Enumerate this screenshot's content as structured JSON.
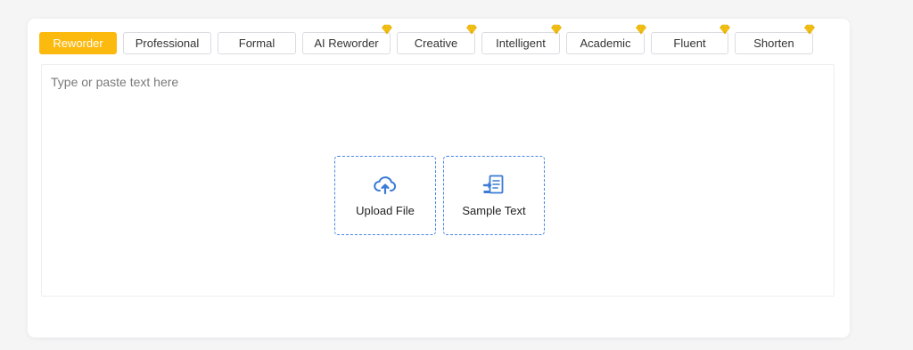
{
  "tabs": [
    {
      "label": "Reworder",
      "active": true,
      "premium": false
    },
    {
      "label": "Professional",
      "active": false,
      "premium": false
    },
    {
      "label": "Formal",
      "active": false,
      "premium": false
    },
    {
      "label": "AI Reworder",
      "active": false,
      "premium": true
    },
    {
      "label": "Creative",
      "active": false,
      "premium": true
    },
    {
      "label": "Intelligent",
      "active": false,
      "premium": true
    },
    {
      "label": "Academic",
      "active": false,
      "premium": true
    },
    {
      "label": "Fluent",
      "active": false,
      "premium": true
    },
    {
      "label": "Shorten",
      "active": false,
      "premium": true
    }
  ],
  "editor": {
    "placeholder": "Type or paste text here"
  },
  "actions": {
    "upload": {
      "label": "Upload File",
      "icon": "cloud-upload-icon"
    },
    "sample": {
      "label": "Sample Text",
      "icon": "sample-text-icon"
    }
  },
  "colors": {
    "accent": "#fcb90e",
    "link": "#3a7bd5",
    "premium_gem": "#f5c518"
  }
}
